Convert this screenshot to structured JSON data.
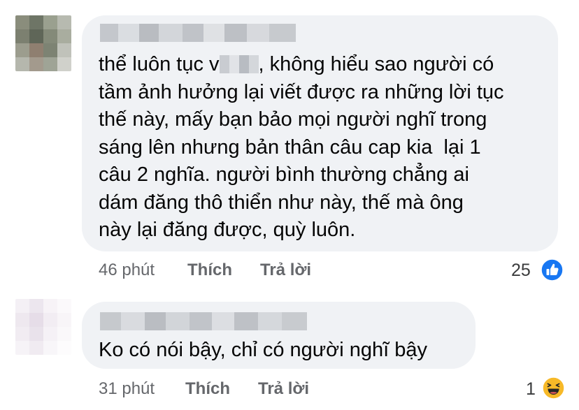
{
  "comments": [
    {
      "text_before": "thể luôn tục v",
      "text_after": ", không hiểu sao người có\ntầm ảnh hưởng lại viết được ra những lời tục\nthế này, mấy bạn bảo mọi người nghĩ trong\nsáng lên nhưng bản thân câu cap kia  lại 1\ncâu 2 nghĩa. người bình thường chẳng ai\ndám đăng thô thiển như này, thế mà ông\nnày lại đăng được, quỳ luôn.",
      "time": "46 phút",
      "like_label": "Thích",
      "reply_label": "Trả lời",
      "reaction_count": "25",
      "reaction_icon": "like-icon",
      "reaction_color": "#1877f2"
    },
    {
      "text": "Ko có nói bậy, chỉ có người nghĩ bậy",
      "time": "31 phút",
      "like_label": "Thích",
      "reply_label": "Trả lời",
      "reaction_count": "1",
      "reaction_icon": "haha-icon",
      "reaction_color": "#f7b928"
    }
  ]
}
